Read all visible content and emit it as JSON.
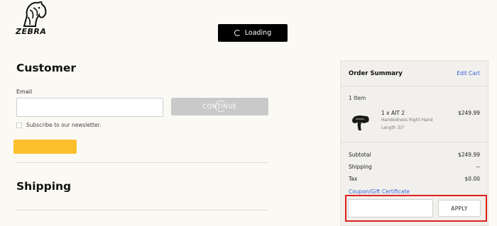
{
  "brand": {
    "name": "ZEBRA"
  },
  "toast": {
    "text": "Loading"
  },
  "customer": {
    "title": "Customer",
    "email_label": "Email",
    "email_value": "",
    "continue_label": "CONTINUE",
    "subscribe_label": "Subscribe to our newsletter."
  },
  "shipping": {
    "title": "Shipping"
  },
  "summary": {
    "title": "Order Summary",
    "edit_label": "Edit Cart",
    "item_count": "1 Item",
    "item": {
      "name": "1 x AIT 2",
      "price": "$249.99",
      "options": [
        "Handedness Right Hand",
        "Length 33\""
      ]
    },
    "rows": [
      {
        "label": "Subtotal",
        "value": "$249.99"
      },
      {
        "label": "Shipping",
        "value": "--"
      },
      {
        "label": "Tax",
        "value": "$0.00"
      }
    ],
    "coupon_label": "Coupon/Gift Certificate",
    "coupon_value": "",
    "apply_label": "APPLY"
  },
  "colors": {
    "accent_link": "#3c62d8",
    "primary_button": "#fdc02d",
    "highlight": "#e0201c"
  }
}
